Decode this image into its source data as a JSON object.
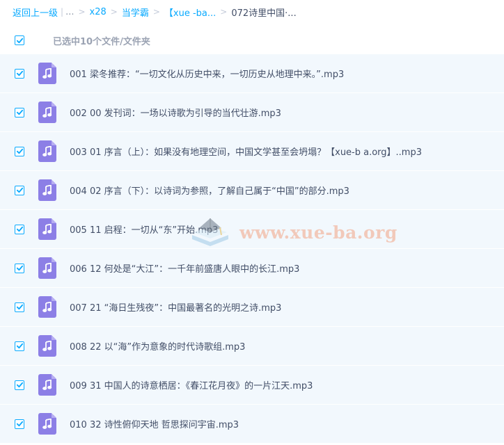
{
  "breadcrumb": {
    "back": "返回上一级",
    "ellipsis": "...",
    "items": [
      "x28",
      "当学霸",
      "【xue -ba..."
    ],
    "current": "072诗里中国·..."
  },
  "selection": {
    "label": "已选中10个文件/文件夹",
    "checked": true
  },
  "files": [
    {
      "name": "001 梁冬推荐：“一切文化从历史中来，一切历史从地理中来。”.mp3",
      "checked": true,
      "icon": "music-icon"
    },
    {
      "name": "002 00 发刊词：一场以诗歌为引导的当代壮游.mp3",
      "checked": true,
      "icon": "music-icon"
    },
    {
      "name": "003 01 序言（上）：如果没有地理空间，中国文学甚至会坍塌？【xue-b a.org】..mp3",
      "checked": true,
      "icon": "music-icon"
    },
    {
      "name": "004 02 序言（下）：以诗词为参照，了解自己属于“中国”的部分.mp3",
      "checked": true,
      "icon": "music-icon"
    },
    {
      "name": "005 11 启程：一切从“东”开始.mp3",
      "checked": true,
      "icon": "music-icon"
    },
    {
      "name": "006 12 何处是“大江”：一千年前盛唐人眼中的长江.mp3",
      "checked": true,
      "icon": "music-icon"
    },
    {
      "name": "007 21 “海日生残夜”：中国最著名的光明之诗.mp3",
      "checked": true,
      "icon": "music-icon"
    },
    {
      "name": "008 22 以“海”作为意象的时代诗歌组.mp3",
      "checked": true,
      "icon": "music-icon"
    },
    {
      "name": "009 31 中国人的诗意栖居：《春江花月夜》的一片江天.mp3",
      "checked": true,
      "icon": "music-icon"
    },
    {
      "name": "010 32 诗性俯仰天地 哲思探问宇宙.mp3",
      "checked": true,
      "icon": "music-icon"
    }
  ],
  "watermark": {
    "text": "www.xue-ba.org"
  },
  "colors": {
    "accent": "#09aaff",
    "row_background": "#f2f8fd",
    "audio_icon": "#8c7fe6",
    "watermark": "#f2a484"
  }
}
